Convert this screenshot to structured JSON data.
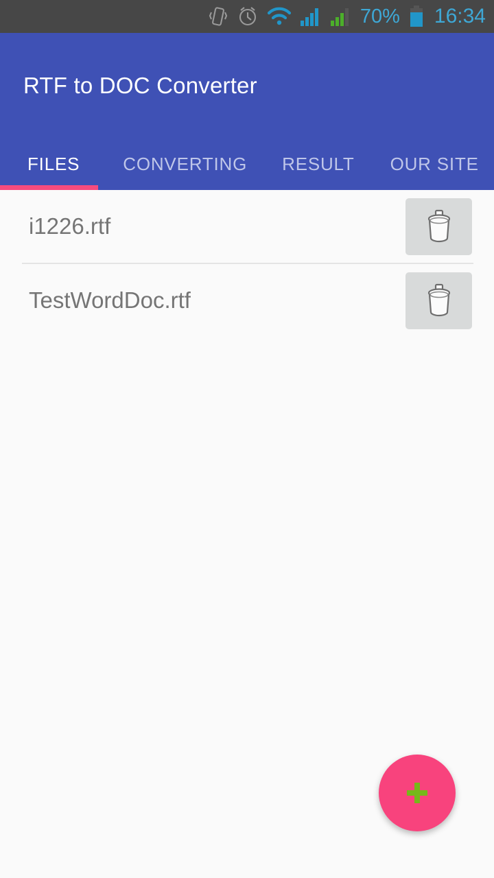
{
  "statusbar": {
    "icons": [
      "vibrate-icon",
      "alarm-icon",
      "wifi-icon",
      "signal-sim1-icon",
      "signal-sim2-icon"
    ],
    "battery_percent": "70%",
    "battery_icon": "battery-icon",
    "time": "16:34",
    "background_color": "#474747",
    "text_color": "#3ea8d6"
  },
  "appbar": {
    "title": "RTF to DOC Converter",
    "background_color": "#3f51b5",
    "title_color": "#ffffff",
    "indicator_color": "#f74b7e",
    "tabs": [
      {
        "label": "FILES",
        "active": true
      },
      {
        "label": "CONVERTING",
        "active": false
      },
      {
        "label": "RESULT",
        "active": false
      },
      {
        "label": "OUR SITE",
        "active": false
      }
    ]
  },
  "file_list": {
    "rows": [
      {
        "name": "i1226.rtf",
        "delete_icon": "trash-icon"
      },
      {
        "name": "TestWordDoc.rtf",
        "delete_icon": "trash-icon"
      }
    ],
    "text_color": "#757575",
    "background_color": "#fafafa"
  },
  "fab": {
    "icon": "plus-icon",
    "background_color": "#f8437d",
    "icon_color": "#76b81a"
  }
}
